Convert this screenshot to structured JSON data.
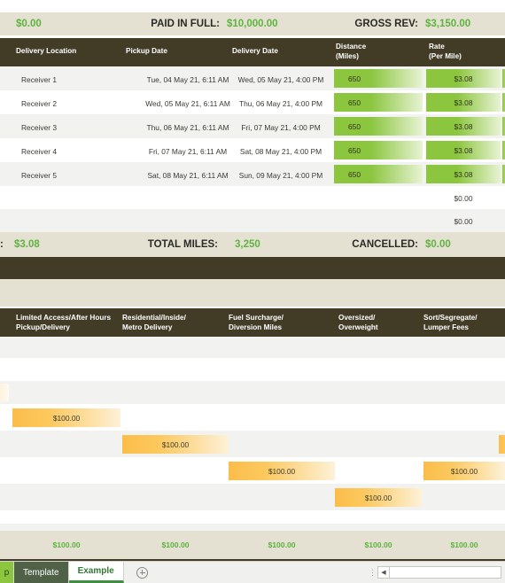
{
  "summary_top": {
    "left_value": "$0.00",
    "mid_label": "PAID IN FULL:",
    "mid_value": "$10,000.00",
    "right_label": "GROSS REV:",
    "right_value": "$3,150.00"
  },
  "shipment_table": {
    "headers": [
      "Delivery Location",
      "Pickup Date",
      "Delivery Date",
      "Distance\n(Miles)",
      "Rate\n(Per Mile)"
    ],
    "rows": [
      {
        "location": "Receiver 1",
        "pickup": "Tue, 04 May 21, 6:11 AM",
        "delivery": "Wed, 05 May 21, 4:00 PM",
        "distance": "650",
        "rate": "$3.08"
      },
      {
        "location": "Receiver 2",
        "pickup": "Wed, 05 May 21, 6:11 AM",
        "delivery": "Thu, 06 May 21, 4:00 PM",
        "distance": "650",
        "rate": "$3.08"
      },
      {
        "location": "Receiver 3",
        "pickup": "Thu, 06 May 21, 6:11 AM",
        "delivery": "Fri, 07 May 21, 4:00 PM",
        "distance": "650",
        "rate": "$3.08"
      },
      {
        "location": "Receiver 4",
        "pickup": "Fri, 07 May 21, 6:11 AM",
        "delivery": "Sat, 08 May 21, 4:00 PM",
        "distance": "650",
        "rate": "$3.08"
      },
      {
        "location": "Receiver 5",
        "pickup": "Sat, 08 May 21, 6:11 AM",
        "delivery": "Sun, 09 May 21, 4:00 PM",
        "distance": "650",
        "rate": "$3.08"
      }
    ],
    "empty_rows": [
      {
        "rate": "$0.00"
      },
      {
        "rate": "$0.00"
      }
    ]
  },
  "summary_bottom": {
    "left_colon": ":",
    "left_value": "$3.08",
    "mid_label": "TOTAL MILES:",
    "mid_value": "3,250",
    "right_label": "CANCELLED:",
    "right_value": "$0.00"
  },
  "accessorial_table": {
    "headers": [
      "Limited Access/After Hours\nPickup/Delivery",
      "Residential/Inside/\nMetro Delivery",
      "Fuel Surcharge/\nDiversion Miles",
      "Oversized/\nOverweight",
      "Sort/Segregate/\nLumper Fees"
    ],
    "charges": [
      {
        "col": 0,
        "value": "$100.00"
      },
      {
        "col": 1,
        "value": "$100.00"
      },
      {
        "col": 2,
        "value": "$100.00"
      },
      {
        "col": 4,
        "value": "$100.00"
      },
      {
        "col": 3,
        "value": "$100.00"
      }
    ],
    "totals": [
      "$100.00",
      "$100.00",
      "$100.00",
      "$100.00",
      "$100.00"
    ]
  },
  "tabbar": {
    "tabs": [
      {
        "label": "p",
        "state": "cut"
      },
      {
        "label": "Template",
        "state": "inactive"
      },
      {
        "label": "Example",
        "state": "active"
      }
    ],
    "add_sheet_icon": "plus-circle-icon",
    "split_handle_icon": "split-handle-icon",
    "scroll_left_icon": "triangle-left-icon"
  },
  "colors": {
    "dark_header": "#423c27",
    "tan": "#e4e0d2",
    "alt_row": "#f2f2f0",
    "green_value": "#5fb33f",
    "green_bar": "#8cc63f",
    "orange_bar": "#fbbd4a"
  }
}
